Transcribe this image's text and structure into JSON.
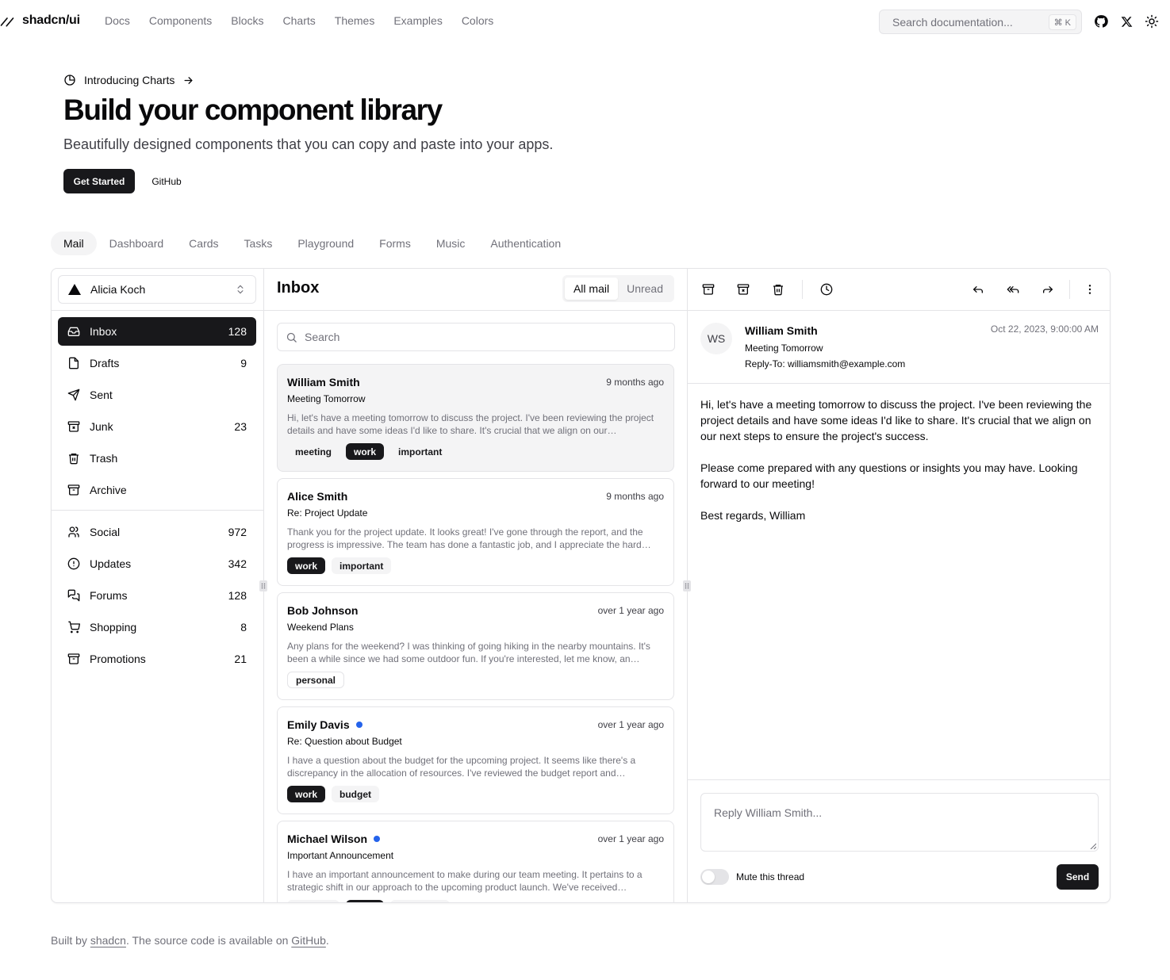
{
  "site": {
    "brand": "shadcn/ui",
    "nav": [
      "Docs",
      "Components",
      "Blocks",
      "Charts",
      "Themes",
      "Examples",
      "Colors"
    ],
    "search_placeholder": "Search documentation...",
    "search_shortcut": "⌘ K"
  },
  "hero": {
    "announcement": "Introducing Charts",
    "title": "Build your component library",
    "subtitle": "Beautifully designed components that you can copy and paste into your apps.",
    "primary_button": "Get Started",
    "secondary_button": "GitHub"
  },
  "example_tabs": [
    "Mail",
    "Dashboard",
    "Cards",
    "Tasks",
    "Playground",
    "Forms",
    "Music",
    "Authentication"
  ],
  "mail": {
    "account": "Alicia Koch",
    "folders": [
      {
        "label": "Inbox",
        "count": "128",
        "icon": "inbox-icon",
        "active": true
      },
      {
        "label": "Drafts",
        "count": "9",
        "icon": "file-icon"
      },
      {
        "label": "Sent",
        "count": "",
        "icon": "send-icon"
      },
      {
        "label": "Junk",
        "count": "23",
        "icon": "archive-x-icon"
      },
      {
        "label": "Trash",
        "count": "",
        "icon": "trash-icon"
      },
      {
        "label": "Archive",
        "count": "",
        "icon": "archive-icon"
      }
    ],
    "categories": [
      {
        "label": "Social",
        "count": "972",
        "icon": "users-icon"
      },
      {
        "label": "Updates",
        "count": "342",
        "icon": "alert-circle-icon"
      },
      {
        "label": "Forums",
        "count": "128",
        "icon": "messages-icon"
      },
      {
        "label": "Shopping",
        "count": "8",
        "icon": "cart-icon"
      },
      {
        "label": "Promotions",
        "count": "21",
        "icon": "archive-icon"
      }
    ],
    "list_title": "Inbox",
    "filter_all": "All mail",
    "filter_unread": "Unread",
    "search_placeholder": "Search",
    "messages": [
      {
        "from": "William Smith",
        "time": "9 months ago",
        "subject": "Meeting Tomorrow",
        "preview": "Hi, let's have a meeting tomorrow to discuss the project. I've been reviewing the project details and have some ideas I'd like to share. It's crucial that we align on our…",
        "tags": [
          "meeting",
          "work",
          "important"
        ],
        "unread": false
      },
      {
        "from": "Alice Smith",
        "time": "9 months ago",
        "subject": "Re: Project Update",
        "preview": "Thank you for the project update. It looks great! I've gone through the report, and the progress is impressive. The team has done a fantastic job, and I appreciate the hard…",
        "tags": [
          "work",
          "important"
        ],
        "unread": false
      },
      {
        "from": "Bob Johnson",
        "time": "over 1 year ago",
        "subject": "Weekend Plans",
        "preview": "Any plans for the weekend? I was thinking of going hiking in the nearby mountains. It's been a while since we had some outdoor fun. If you're interested, let me know, an…",
        "tags": [
          "personal"
        ],
        "unread": false
      },
      {
        "from": "Emily Davis",
        "time": "over 1 year ago",
        "subject": "Re: Question about Budget",
        "preview": "I have a question about the budget for the upcoming project. It seems like there's a discrepancy in the allocation of resources. I've reviewed the budget report and…",
        "tags": [
          "work",
          "budget"
        ],
        "unread": true
      },
      {
        "from": "Michael Wilson",
        "time": "over 1 year ago",
        "subject": "Important Announcement",
        "preview": "I have an important announcement to make during our team meeting. It pertains to a strategic shift in our approach to the upcoming product launch. We've received…",
        "tags": [
          "meeting",
          "work",
          "important"
        ],
        "unread": true
      }
    ],
    "detail": {
      "initials": "WS",
      "from": "William Smith",
      "subject": "Meeting Tomorrow",
      "reply_to_label": "Reply-To:",
      "reply_to": "williamsmith@example.com",
      "date": "Oct 22, 2023, 9:00:00 AM",
      "body": [
        "Hi, let's have a meeting tomorrow to discuss the project. I've been reviewing the project details and have some ideas I'd like to share. It's crucial that we align on our next steps to ensure the project's success.",
        "Please come prepared with any questions or insights you may have. Looking forward to our meeting!",
        "Best regards, William"
      ],
      "reply_placeholder": "Reply William Smith...",
      "mute_label": "Mute this thread",
      "send_label": "Send"
    }
  },
  "footer": {
    "prefix": "Built by",
    "author": "shadcn",
    "middle": ". The source code is available on",
    "repo": "GitHub",
    "suffix": "."
  }
}
